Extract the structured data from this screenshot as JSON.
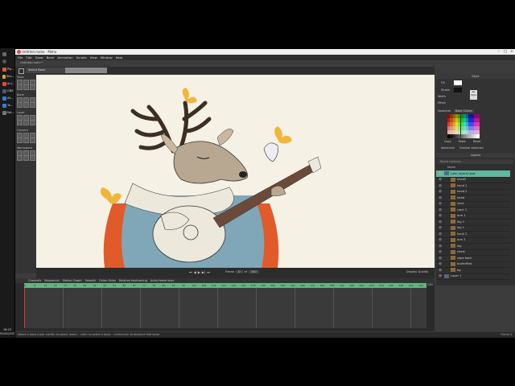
{
  "taskbar": {
    "items": [
      {
        "label": "Pla...",
        "color": "#e05a3a"
      },
      {
        "label": "Sho...",
        "color": "#d9a52b"
      },
      {
        "label": "Uni...",
        "color": "#e24a3a"
      },
      {
        "label": "OBS",
        "color": "#555566"
      },
      {
        "label": "Ali...",
        "color": "#3a7bd5"
      },
      {
        "label": "Ta...",
        "color": "#3a7bd5"
      },
      {
        "label": "Set...",
        "color": "#777777"
      }
    ],
    "time": "16:23",
    "date": "05/02/2021"
  },
  "window": {
    "title": "Untitled.moho - Moho",
    "menu": [
      "File",
      "Edit",
      "Draw",
      "Bone",
      "Animation",
      "Scripts",
      "View",
      "Window",
      "Help"
    ],
    "doc_tab": "Untitled.moho *"
  },
  "toolbar": {
    "tool_select": "Select Bone"
  },
  "leftpanel": {
    "sections": [
      "Tools",
      "Bone",
      "Layer",
      "Camera",
      "Workspace"
    ]
  },
  "canvas_bar": {
    "frame_label": "Frame",
    "frame": "0",
    "of_label": "of",
    "total": "240",
    "quality": "Display Quality"
  },
  "style_panel": {
    "title": "Style",
    "fill_label": "Fill",
    "stroke_label": "Stroke",
    "width_label": "Width",
    "effect_label": "Effect",
    "no_style": "No Style",
    "swatches_label": "Swatches",
    "swatch_set": "Basic Colors",
    "copy": "Copy",
    "paste": "Paste",
    "reset": "Reset",
    "advanced": "Advanced",
    "checker": "Checker selection"
  },
  "layers_panel": {
    "title": "Layers",
    "search_placeholder": "Name contains...",
    "name_header": "Name",
    "items": [
      {
        "name": "Lute_layers2.psd",
        "selected": true,
        "indent": 0
      },
      {
        "name": "head2",
        "selected": false,
        "indent": 1
      },
      {
        "name": "hand 1",
        "selected": false,
        "indent": 1
      },
      {
        "name": "head 2",
        "selected": false,
        "indent": 1
      },
      {
        "name": "head",
        "selected": false,
        "indent": 1
      },
      {
        "name": "neck",
        "selected": false,
        "indent": 1
      },
      {
        "name": "cape 1",
        "selected": false,
        "indent": 1
      },
      {
        "name": "arm 1",
        "selected": false,
        "indent": 1
      },
      {
        "name": "leg 2",
        "selected": false,
        "indent": 1
      },
      {
        "name": "leg 1",
        "selected": false,
        "indent": 1
      },
      {
        "name": "hand 2",
        "selected": false,
        "indent": 1
      },
      {
        "name": "arm 2",
        "selected": false,
        "indent": 1
      },
      {
        "name": "leg",
        "selected": false,
        "indent": 1
      },
      {
        "name": "chest",
        "selected": false,
        "indent": 1
      },
      {
        "name": "cape back",
        "selected": false,
        "indent": 1
      },
      {
        "name": "butterflies",
        "selected": false,
        "indent": 1
      },
      {
        "name": "bg",
        "selected": false,
        "indent": 1
      },
      {
        "name": "Layer 1",
        "selected": false,
        "indent": 0
      }
    ]
  },
  "timeline": {
    "tabs": [
      "Channels",
      "Sequencer",
      "Motion Graph",
      "Smooth",
      "Onion Skins",
      "Relative keyframing",
      "Auto-freeze keys"
    ],
    "ruler": [
      "0",
      "6",
      "12",
      "18",
      "24",
      "30",
      "36",
      "42",
      "48",
      "54",
      "60",
      "66",
      "72",
      "78",
      "84",
      "90",
      "96",
      "102",
      "108",
      "114",
      "120",
      "126",
      "132",
      "138",
      "144",
      "150",
      "156",
      "162",
      "168",
      "174",
      "180",
      "186",
      "192",
      "198",
      "204",
      "210",
      "216",
      "222",
      "228",
      "234",
      "240"
    ],
    "end_value": "240"
  },
  "statusbar": {
    "text": "Select a bone (hold <shift> to select more) - <alt> to select a bone - <ctrl/cmd> to deselect that bone",
    "frame": "Frame 0"
  },
  "colors": {
    "canvas_bg": "#f5f1e4",
    "selection": "#5fb7a0",
    "ruler": "#62b57f",
    "butterfly": "#f0b63a",
    "cape": "#e05a2a"
  }
}
